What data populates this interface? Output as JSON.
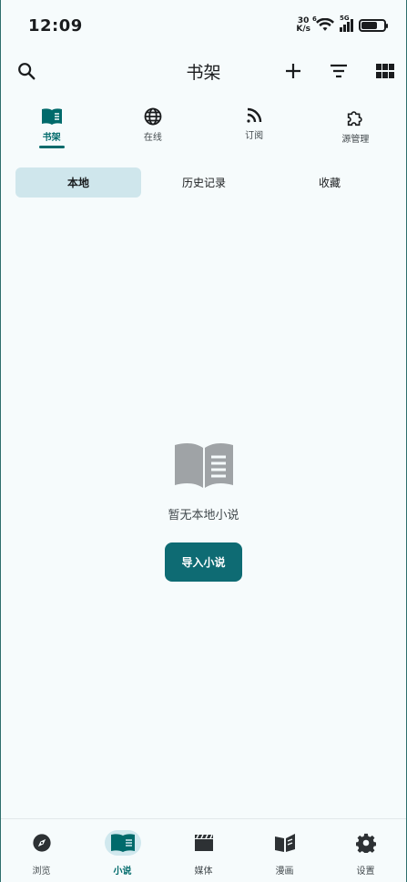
{
  "status": {
    "time": "12:09",
    "netspeed_value": "30",
    "netspeed_unit": "K/s",
    "wifi_badge": "6",
    "signal_badge": "5G"
  },
  "app_bar": {
    "title": "书架",
    "icons": [
      "search-icon",
      "add-icon",
      "filter-icon",
      "grid-view-icon"
    ]
  },
  "top_tabs": [
    {
      "label": "书架",
      "icon": "book-open-icon",
      "active": true
    },
    {
      "label": "在线",
      "icon": "globe-icon",
      "active": false
    },
    {
      "label": "订阅",
      "icon": "rss-icon",
      "active": false
    },
    {
      "label": "源管理",
      "icon": "puzzle-icon",
      "active": false
    }
  ],
  "segments": [
    {
      "label": "本地",
      "active": true
    },
    {
      "label": "历史记录",
      "active": false
    },
    {
      "label": "收藏",
      "active": false
    }
  ],
  "empty_state": {
    "message": "暂无本地小说",
    "button_label": "导入小说"
  },
  "bottom_nav": [
    {
      "label": "浏览",
      "icon": "compass-icon",
      "active": false
    },
    {
      "label": "小说",
      "icon": "book-icon",
      "active": true
    },
    {
      "label": "媒体",
      "icon": "clapperboard-icon",
      "active": false
    },
    {
      "label": "漫画",
      "icon": "manga-book-icon",
      "active": false
    },
    {
      "label": "设置",
      "icon": "gear-icon",
      "active": false
    }
  ],
  "colors": {
    "accent": "#006a6b",
    "button": "#0e6b73",
    "active_segment": "#cfe6ec",
    "background": "#f6fbfc"
  }
}
